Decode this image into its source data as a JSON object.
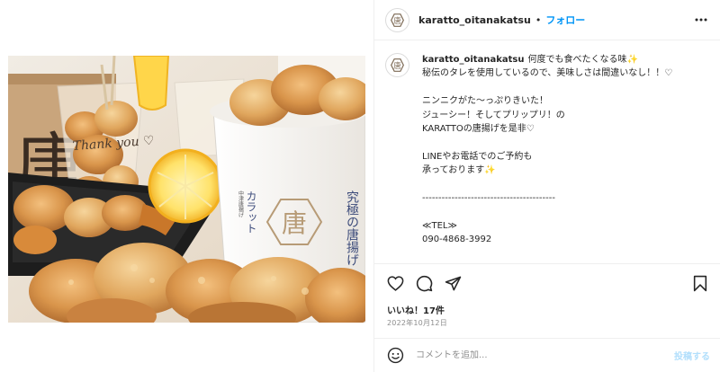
{
  "post": {
    "username": "karatto_oitanakatsu",
    "dot": "•",
    "follow_label": "フォロー"
  },
  "caption": {
    "username": "karatto_oitanakatsu",
    "lines": [
      "何度でも食べたくなる味",
      "秘伝のタレを使用しているので、美味しさは間違いなし！！♡",
      "",
      "ニンニクがた〜っぷりきいた！",
      "ジューシー！そしてプリップリ！の",
      "KARATTOの唐揚げを是非♡",
      "",
      "LINEやお電話でのご予約も",
      "承っております",
      "",
      "-----------------------------------------",
      "",
      "≪TEL≫",
      "090-4868-3992",
      "",
      "-----------------------------------------"
    ],
    "sparkle": "✨"
  },
  "photo": {
    "bag_text": "唐",
    "cup_text": "Thank you ♡",
    "bucket_small": "中津唐揚げ",
    "bucket_brand": "カラット",
    "bucket_tagline": "究極の唐揚げ",
    "logo_char": "唐"
  },
  "engagement": {
    "likes": "いいね！17件",
    "date": "2022年10月12日"
  },
  "comment": {
    "placeholder": "コメントを追加...",
    "post_label": "投稿する"
  },
  "colors": {
    "accent": "#0095f6",
    "post_disabled": "#b2dffc"
  },
  "icons": {
    "more": "more-options-icon",
    "like": "heart-icon",
    "comment": "comment-icon",
    "share": "share-icon",
    "save": "bookmark-icon",
    "emoji": "emoji-icon"
  }
}
